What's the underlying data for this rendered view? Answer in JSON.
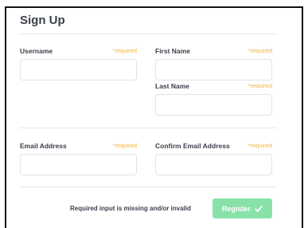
{
  "form": {
    "title": "Sign Up",
    "fields": {
      "username": {
        "label": "Username",
        "required": "*required",
        "value": ""
      },
      "first_name": {
        "label": "First Name",
        "required": "*required",
        "value": ""
      },
      "last_name": {
        "label": "Last Name",
        "required": "*required",
        "value": ""
      },
      "email": {
        "label": "Email Address",
        "required": "*required",
        "value": ""
      },
      "confirm_email": {
        "label": "Confirm Email Address",
        "required": "*required",
        "value": ""
      }
    },
    "validation_message": "Required input is missing and/or invalid",
    "register_label": "Register"
  },
  "icons": {
    "register": "check-icon"
  },
  "colors": {
    "required": "#f4b33a",
    "register_button": "#88e2a8",
    "text": "#3b3f4a"
  }
}
